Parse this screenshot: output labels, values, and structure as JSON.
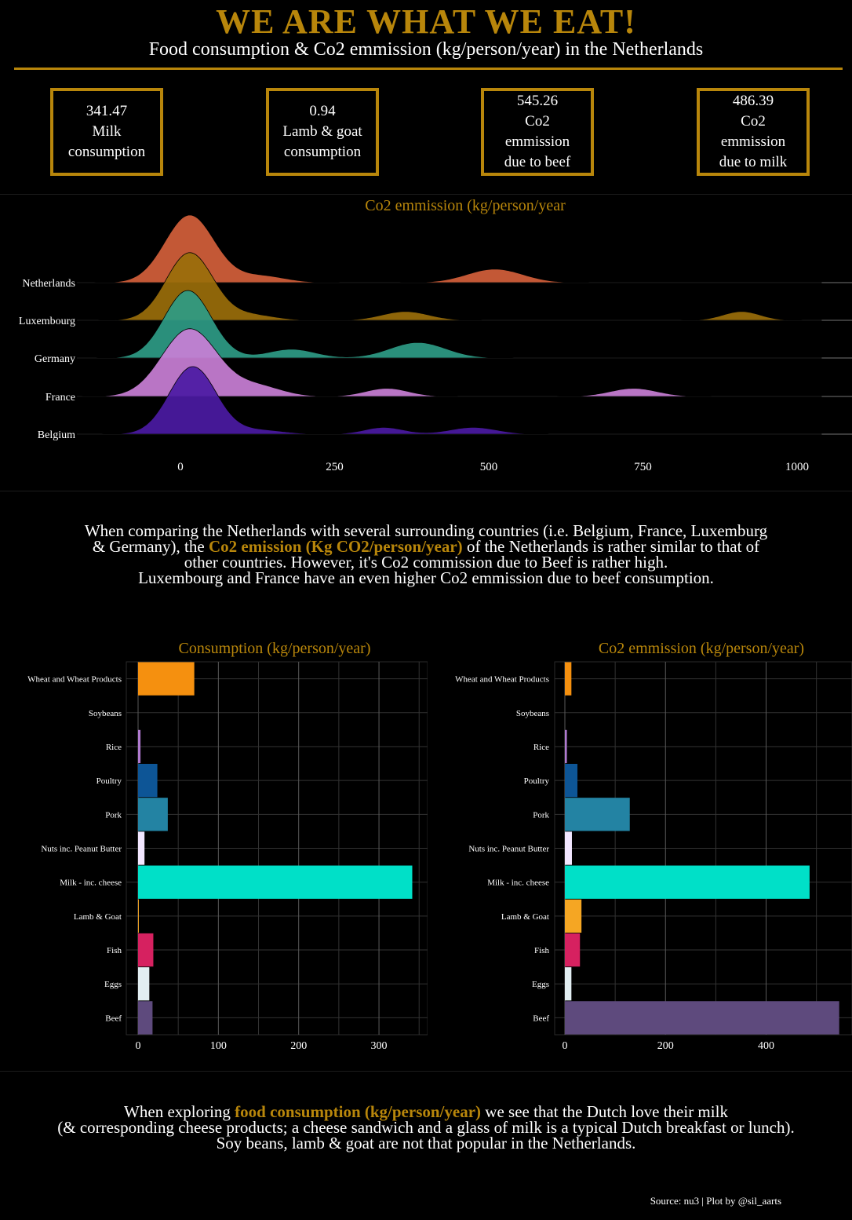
{
  "header": {
    "title": "WE ARE WHAT WE EAT!",
    "subtitle": "Food consumption & Co2 emmission (kg/person/year) in the Netherlands"
  },
  "kpis": [
    {
      "value": "341.47",
      "label": "Milk consumption",
      "lines": [
        "Milk",
        "consumption"
      ]
    },
    {
      "value": "0.94",
      "label": "Lamb & goat consumption",
      "lines": [
        "Lamb & goat",
        "consumption"
      ]
    },
    {
      "value": "545.26",
      "label": "Co2 emmission due to beef",
      "lines": [
        "Co2",
        "emmission",
        "due to beef"
      ]
    },
    {
      "value": "486.39",
      "label": "Co2 emmission due to milk",
      "lines": [
        "Co2",
        "emmission",
        "due to milk"
      ]
    }
  ],
  "paragraph1": {
    "line1": "When comparing the Netherlands with several surrounding countries (i.e. Belgium, France, Luxemburg",
    "line2a": "& Germany), the ",
    "line2b": "Co2 emission (Kg CO2/person/year)",
    "line2c": " of the Netherlands is rather similar to that of",
    "line3": "other countries. However, it's Co2 commission due to Beef is rather high.",
    "line4": "Luxembourg and France have an even higher Co2 emmission due to beef consumption."
  },
  "paragraph2": {
    "line1a": "When exploring ",
    "line1b": "food consumption (kg/person/year)",
    "line1c": " we see that the Dutch love their milk",
    "line2": "(& corresponding cheese products; a cheese sandwich and a glass of milk is a typical Dutch breakfast or lunch).",
    "line3": "Soy beans, lamb & goat are not that popular in the Netherlands."
  },
  "source": "Source: nu3 | Plot by @sil_aarts",
  "colors": {
    "accent": "#b8860b"
  },
  "chart_data": [
    {
      "type": "area",
      "subtype": "ridgeline-density",
      "title": "Co2 emmission (kg/person/year",
      "x_ticks": [
        0,
        250,
        500,
        750,
        1000
      ],
      "xlim": [
        -170,
        1040
      ],
      "series": [
        {
          "name": "Netherlands",
          "color": "#d4603b",
          "peaks": [
            {
              "mu": 15,
              "sigma": 40,
              "h": 1.0
            },
            {
              "mu": 130,
              "sigma": 40,
              "h": 0.1
            },
            {
              "mu": 510,
              "sigma": 45,
              "h": 0.2
            }
          ]
        },
        {
          "name": "Luxembourg",
          "color": "#9a6e0a",
          "peaks": [
            {
              "mu": 15,
              "sigma": 38,
              "h": 1.0
            },
            {
              "mu": 115,
              "sigma": 38,
              "h": 0.08
            },
            {
              "mu": 365,
              "sigma": 38,
              "h": 0.13
            },
            {
              "mu": 910,
              "sigma": 30,
              "h": 0.13
            }
          ]
        },
        {
          "name": "Germany",
          "color": "#2e9b86",
          "peaks": [
            {
              "mu": 12,
              "sigma": 38,
              "h": 1.0
            },
            {
              "mu": 180,
              "sigma": 38,
              "h": 0.13
            },
            {
              "mu": 385,
              "sigma": 45,
              "h": 0.23
            }
          ]
        },
        {
          "name": "France",
          "color": "#c97fd6",
          "peaks": [
            {
              "mu": 15,
              "sigma": 45,
              "h": 1.0
            },
            {
              "mu": 125,
              "sigma": 40,
              "h": 0.15
            },
            {
              "mu": 335,
              "sigma": 35,
              "h": 0.12
            },
            {
              "mu": 735,
              "sigma": 38,
              "h": 0.12
            }
          ]
        },
        {
          "name": "Belgium",
          "color": "#4b1aa3",
          "peaks": [
            {
              "mu": 20,
              "sigma": 38,
              "h": 1.0
            },
            {
              "mu": 130,
              "sigma": 38,
              "h": 0.06
            },
            {
              "mu": 330,
              "sigma": 32,
              "h": 0.1
            },
            {
              "mu": 475,
              "sigma": 38,
              "h": 0.1
            }
          ]
        }
      ]
    },
    {
      "type": "bar",
      "orientation": "horizontal",
      "title": "Consumption (kg/person/year)",
      "categories": [
        "Wheat and Wheat Products",
        "Soybeans",
        "Rice",
        "Poultry",
        "Pork",
        "Nuts inc. Peanut Butter",
        "Milk - inc. cheese",
        "Lamb & Goat",
        "Fish",
        "Eggs",
        "Beef"
      ],
      "values": [
        70,
        0,
        3,
        24,
        37,
        8,
        341.47,
        0.94,
        19,
        14,
        18
      ],
      "colors": [
        "#f5900f",
        "#7b2d8e",
        "#b07ad0",
        "#0d5596",
        "#2383a3",
        "#f2e6ff",
        "#00e0c8",
        "#f5a623",
        "#d62160",
        "#e2eef2",
        "#5e4a7d"
      ],
      "x_ticks": [
        0,
        100,
        200,
        300
      ],
      "xlim": [
        -15,
        350
      ]
    },
    {
      "type": "bar",
      "orientation": "horizontal",
      "title": "Co2 emmission (kg/person/year)",
      "categories": [
        "Wheat and Wheat Products",
        "Soybeans",
        "Rice",
        "Poultry",
        "Pork",
        "Nuts inc. Peanut Butter",
        "Milk - inc. cheese",
        "Lamb & Goat",
        "Fish",
        "Eggs",
        "Beef"
      ],
      "values": [
        13,
        0,
        4,
        25,
        129,
        14,
        486.39,
        33,
        30,
        13,
        545.26
      ],
      "colors": [
        "#f5900f",
        "#7b2d8e",
        "#b07ad0",
        "#0d5596",
        "#2383a3",
        "#f2e6ff",
        "#00e0c8",
        "#f5a623",
        "#d62160",
        "#e2eef2",
        "#5e4a7d"
      ],
      "x_ticks": [
        0,
        200,
        400
      ],
      "xlim": [
        -20,
        550
      ]
    }
  ]
}
